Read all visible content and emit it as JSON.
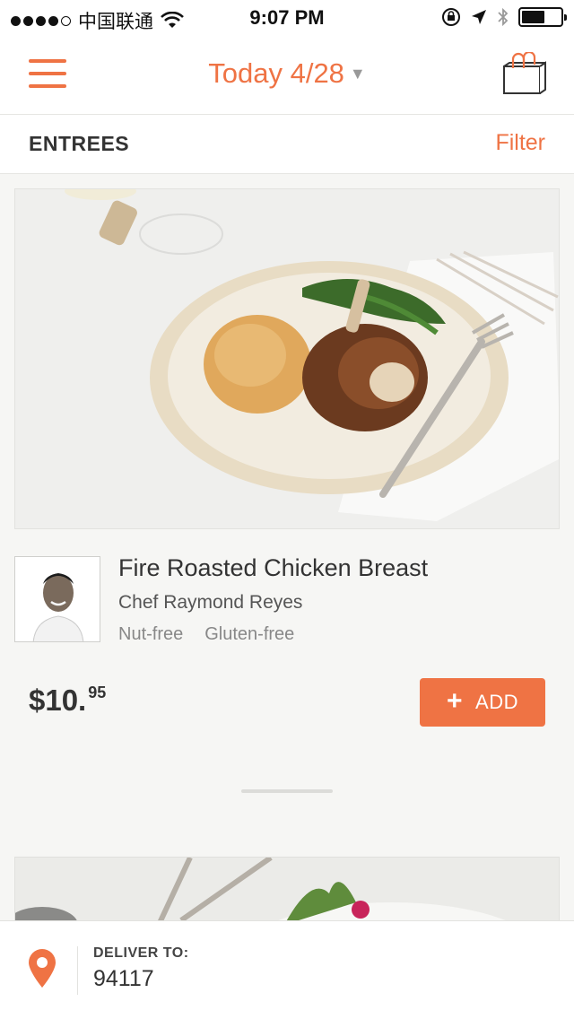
{
  "status_bar": {
    "carrier": "中国联通",
    "time": "9:07 PM",
    "signal_bars": 4,
    "battery_level": 0.6
  },
  "nav": {
    "date_label": "Today 4/28",
    "menu_icon": "hamburger-menu-icon",
    "cart_icon": "shopping-bag-icon"
  },
  "category": {
    "title": "ENTREES",
    "filter_label": "Filter"
  },
  "dish": {
    "name": "Fire Roasted Chicken Breast",
    "chef": "Chef Raymond Reyes",
    "tags": [
      "Nut-free",
      "Gluten-free"
    ],
    "price_dollars": "$10.",
    "price_cents": "95",
    "add_label": "ADD",
    "add_icon": "+"
  },
  "delivery": {
    "label": "DELIVER TO:",
    "zip": "94117"
  },
  "colors": {
    "accent": "#ef7344",
    "text": "#333333",
    "muted": "#888888"
  }
}
